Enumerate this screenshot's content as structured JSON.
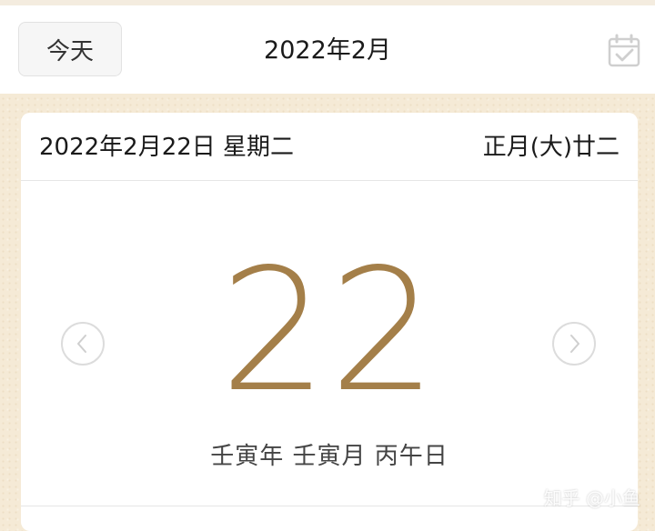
{
  "header": {
    "today_label": "今天",
    "month_title": "2022年2月",
    "calendar_icon": "calendar-check-icon"
  },
  "card": {
    "solar_date": "2022年2月22日 星期二",
    "lunar_date": "正月(大)廿二",
    "day_number": "22",
    "ganzhi": "壬寅年 壬寅月 丙午日",
    "prev_icon": "chevron-left-icon",
    "next_icon": "chevron-right-icon"
  },
  "watermark": "知乎 @小鱼",
  "colors": {
    "accent": "#a47f49",
    "background": "#f5ead6",
    "card": "#ffffff",
    "icon_gray": "#cfcfcf"
  }
}
